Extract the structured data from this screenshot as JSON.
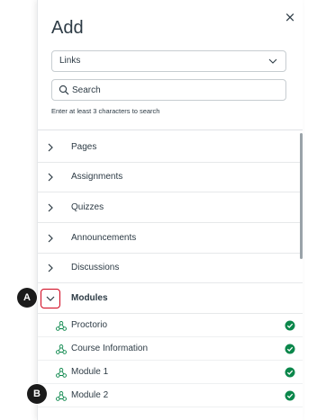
{
  "tray": {
    "title": "Add",
    "close_glyph": "×",
    "link_type": {
      "selected": "Links"
    },
    "search": {
      "placeholder": "Search",
      "value": ""
    },
    "hint": "Enter at least 3 characters to search"
  },
  "categories": [
    {
      "label": "Pages",
      "expanded": false
    },
    {
      "label": "Assignments",
      "expanded": false
    },
    {
      "label": "Quizzes",
      "expanded": false
    },
    {
      "label": "Announcements",
      "expanded": false
    },
    {
      "label": "Discussions",
      "expanded": false
    },
    {
      "label": "Modules",
      "expanded": true
    }
  ],
  "modules": [
    {
      "label": "Proctorio",
      "status": "published"
    },
    {
      "label": "Course Information",
      "status": "published"
    },
    {
      "label": "Module 1",
      "status": "published"
    },
    {
      "label": "Module 2",
      "status": "published"
    }
  ],
  "callouts": {
    "a": "A",
    "b": "B"
  },
  "colors": {
    "text": "#2d3b45",
    "check_green": "#0b874b",
    "module_icon": "#0b874b",
    "focus_outline": "#d0021b",
    "callout_bg": "#1b1b1b"
  },
  "icons": {
    "close": "close-icon",
    "select_caret": "chevron-down-icon",
    "search": "search-icon",
    "collapsed": "chevron-right-icon",
    "expanded": "chevron-down-icon",
    "module": "module-icon",
    "published": "check-circle-icon"
  }
}
